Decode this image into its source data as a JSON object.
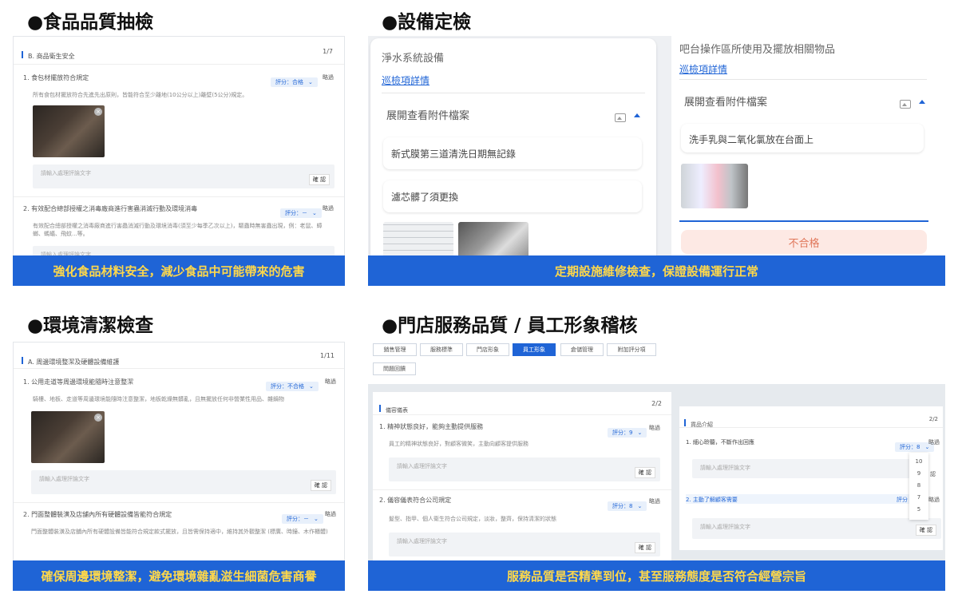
{
  "sections": {
    "food": {
      "title": "●食品品質抽檢",
      "banner": "強化食品材料安全，減少食品中可能帶來的危害",
      "panel": {
        "header": "B. 商品衛生安全",
        "page": "1/7",
        "q1": "1. 食包材擺放符合規定",
        "q1_score": "評分：合格",
        "q1_desc": "所有食包材擺放符合先進先出原則，皆能符合至少離地(10公分以上)離壁(5公分)規定。",
        "placeholder": "請輸入處理評論文字",
        "confirm": "確 認",
        "skip": "略過",
        "q2": "2. 有效配合總部授權之消毒廠商進行害蟲消滅行動及環境消毒",
        "q2_score": "評分：－",
        "q2_desc": "有效配合總部授權之消毒廠商進行害蟲消滅行動及環境消毒(須至少每季乙次以上)，驅蟲時無害蟲出現，例：老鼠、蟑螂、螞蟻、飛蚊...等。",
        "placeholder2": "請輸入處理評論文字"
      }
    },
    "equipment": {
      "title": "●設備定檢",
      "banner": "定期設施維修檢查，保證設備運行正常",
      "left": {
        "name": "淨水系統設備",
        "link": "巡檢項詳情",
        "expand": "展開查看附件檔案",
        "note1": "新式膜第三道清洗日期無記錄",
        "note2": "濾芯髒了須更換"
      },
      "right": {
        "name": "吧台操作區所使用及擺放相關物品",
        "link": "巡檢項詳情",
        "expand": "展開查看附件檔案",
        "note1": "洗手乳與二氧化氯放在台面上",
        "fail": "不合格"
      }
    },
    "environment": {
      "title": "●環境清潔檢查",
      "banner": "確保周邊環境整潔，避免環境雜亂滋生細菌危害商譽",
      "panel": {
        "header": "A. 周邊環境整潔及硬體設備維護",
        "page": "1/11",
        "q1": "1. 公用走道等周邊環境能隨時注意整潔",
        "q1_score": "評分：不合格",
        "q1_desc": "騎樓、地板、走道等周邊環境能隨時注意整潔，地板乾燥無髒亂，且無擺放任何非營業性用品、雜鍋物",
        "placeholder": "請輸入處理評論文字",
        "confirm": "確 認",
        "skip": "略過",
        "q2": "2. 門面整體裝潢及店舖內所有硬體設備皆能符合規定",
        "q2_score": "評分：－",
        "q2_desc": "門面整體裝潢及店舖內所有硬體設備皆能符合規定款式擺放，且皆需保持適中，維持其外觀整潔 (標廣、時鐘、木作櫃體)"
      }
    },
    "service": {
      "title": "●門店服務品質 / 員工形象稽核",
      "banner": "服務品質是否精準到位，甚至服務態度是否符合經營宗旨",
      "tabs": [
        "銷售管理",
        "服務標準",
        "門店形象",
        "員工形象",
        "倉儲管理",
        "附加評分項",
        "問題回饋"
      ],
      "active_tab": "員工形象",
      "left": {
        "header": "儀容儀表",
        "page": "2/2",
        "q1": "1. 精神狀態良好，能夠主動提供服務",
        "q1_score": "評分：9",
        "q1_desc": "員工的精神狀態良好，對顧客微笑，主動向顧客提供服務",
        "placeholder": "請輸入處理評論文字",
        "confirm": "確 認",
        "skip": "略過",
        "q2": "2. 儀容儀表符合公司規定",
        "q2_score": "評分：8",
        "q2_desc": "髮型、指甲、個人衛生符合公司規定，淡妝，整齊，保持清潔的狀態"
      },
      "right": {
        "header": "貨品介紹",
        "page": "2/2",
        "q1": "1. 細心聆聽，不斷作出回應",
        "q1_score": "評分：8",
        "placeholder": "請輸入處理評論文字",
        "confirm": "確 認",
        "skip": "略過",
        "q2": "2. 主動了解顧客需要",
        "q2_score": "評分",
        "dropdown": [
          "10",
          "9",
          "8",
          "7",
          "5"
        ],
        "dd_skip1": "認",
        "dd_skip2": "略過"
      }
    }
  },
  "colors": {
    "accent": "#1f64d6",
    "banner_text": "#ffd84a",
    "fail_bg": "#fde9e4",
    "fail_text": "#e0775a"
  }
}
